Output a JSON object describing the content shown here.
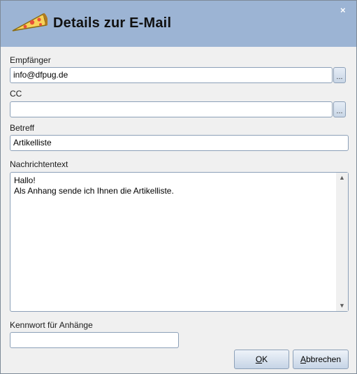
{
  "window": {
    "title": "Details zur E-Mail",
    "close_symbol": "×"
  },
  "form": {
    "recipient_label": "Empfänger",
    "recipient_value": "info@dfpug.de",
    "cc_label": "CC",
    "cc_value": "",
    "subject_label": "Betreff",
    "subject_value": "Artikelliste",
    "body_label": "Nachrichtentext",
    "body_lines": [
      "Hallo!",
      "Als Anhang sende ich Ihnen die Artikelliste."
    ],
    "password_label": "Kennwort für Anhänge",
    "password_value": "",
    "picker_label": "..."
  },
  "buttons": {
    "ok_access": "O",
    "ok_rest": "K",
    "cancel_access": "A",
    "cancel_rest": "bbrechen"
  },
  "colors": {
    "header": "#9cb4d4",
    "field_border": "#8ca0b8"
  },
  "icons": {
    "logo": "pizza-slice-icon",
    "close": "close-icon"
  }
}
